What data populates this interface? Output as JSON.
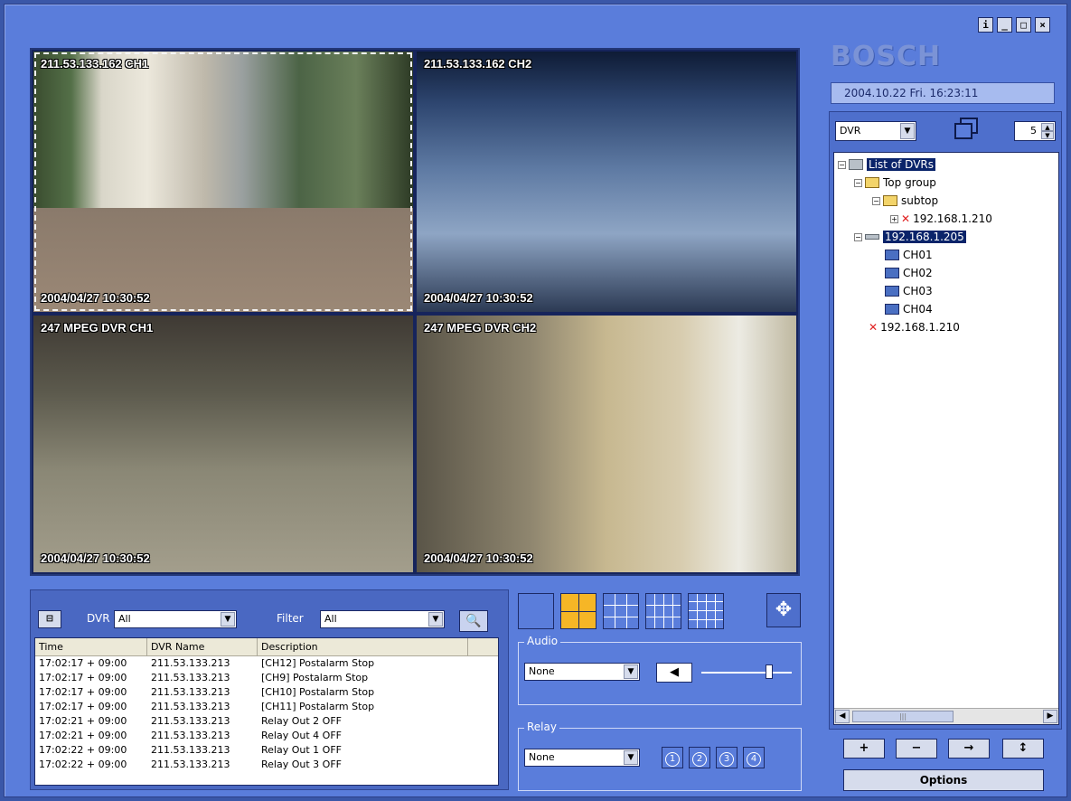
{
  "window": {
    "buttons": [
      "i",
      "_",
      "□",
      "×"
    ]
  },
  "brand": {
    "logo": "BOSCH",
    "datetime": "2004.10.22  Fri.  16:23:11"
  },
  "video": {
    "cells": [
      {
        "label": "211.53.133.162 CH1",
        "timestamp": "2004/04/27 10:30:52"
      },
      {
        "label": "211.53.133.162 CH2",
        "timestamp": "2004/04/27 10:30:52"
      },
      {
        "label": "247 MPEG DVR CH1",
        "timestamp": "2004/04/27 10:30:52"
      },
      {
        "label": "247 MPEG DVR CH2",
        "timestamp": "2004/04/27 10:30:52"
      }
    ]
  },
  "events": {
    "dvr_label": "DVR",
    "dvr_value": "All",
    "filter_label": "Filter",
    "filter_value": "All",
    "columns": [
      "Time",
      "DVR Name",
      "Description"
    ],
    "rows": [
      [
        "17:02:17 + 09:00",
        "211.53.133.213",
        "[CH12] Postalarm Stop"
      ],
      [
        "17:02:17 + 09:00",
        "211.53.133.213",
        "[CH9] Postalarm Stop"
      ],
      [
        "17:02:17 + 09:00",
        "211.53.133.213",
        "[CH10] Postalarm Stop"
      ],
      [
        "17:02:17 + 09:00",
        "211.53.133.213",
        "[CH11] Postalarm Stop"
      ],
      [
        "17:02:21 + 09:00",
        "211.53.133.213",
        "Relay Out 2 OFF"
      ],
      [
        "17:02:21 + 09:00",
        "211.53.133.213",
        "Relay Out 4 OFF"
      ],
      [
        "17:02:22 + 09:00",
        "211.53.133.213",
        "Relay Out 1 OFF"
      ],
      [
        "17:02:22 + 09:00",
        "211.53.133.213",
        "Relay Out 3 OFF"
      ]
    ]
  },
  "audio": {
    "label": "Audio",
    "value": "None",
    "volume_fraction": 0.75
  },
  "relay": {
    "label": "Relay",
    "value": "None",
    "buttons": [
      "1",
      "2",
      "3",
      "4"
    ]
  },
  "tree_panel": {
    "combo_value": "DVR",
    "spinner_value": "5",
    "nodes": {
      "root": "List of DVRs",
      "top_group": "Top group",
      "subtop": "subtop",
      "ip_210_a": "192.168.1.210",
      "ip_205": "192.168.1.205",
      "ch01": "CH01",
      "ch02": "CH02",
      "ch03": "CH03",
      "ch04": "CH04",
      "ip_210_b": "192.168.1.210"
    }
  },
  "bottom_buttons": [
    "+",
    "−",
    "→",
    "↕"
  ],
  "options_label": "Options",
  "colors": {
    "active_layout": "#f6b626",
    "panel_bg": "#5a7ddb",
    "selection": "#0a246a"
  }
}
